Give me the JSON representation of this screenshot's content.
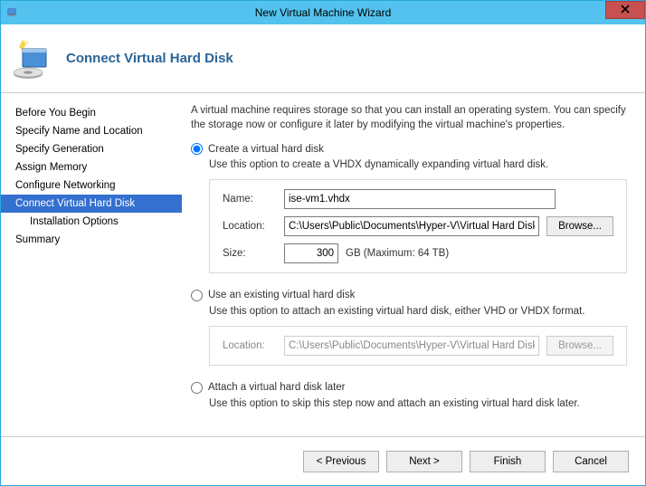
{
  "window": {
    "title": "New Virtual Machine Wizard"
  },
  "header": {
    "title": "Connect Virtual Hard Disk"
  },
  "sidebar": {
    "items": [
      {
        "label": "Before You Begin"
      },
      {
        "label": "Specify Name and Location"
      },
      {
        "label": "Specify Generation"
      },
      {
        "label": "Assign Memory"
      },
      {
        "label": "Configure Networking"
      },
      {
        "label": "Connect Virtual Hard Disk",
        "selected": true,
        "children": [
          {
            "label": "Installation Options"
          }
        ]
      },
      {
        "label": "Summary"
      }
    ]
  },
  "content": {
    "intro": "A virtual machine requires storage so that you can install an operating system. You can specify the storage now or configure it later by modifying the virtual machine's properties.",
    "option_create": {
      "label": "Create a virtual hard disk",
      "hint": "Use this option to create a VHDX dynamically expanding virtual hard disk.",
      "name_label": "Name:",
      "name_value": "ise-vm1.vhdx",
      "location_label": "Location:",
      "location_value": "C:\\Users\\Public\\Documents\\Hyper-V\\Virtual Hard Disks\\",
      "browse_label": "Browse...",
      "size_label": "Size:",
      "size_value": "300",
      "size_unit": "GB (Maximum: 64 TB)"
    },
    "option_existing": {
      "label": "Use an existing virtual hard disk",
      "hint": "Use this option to attach an existing virtual hard disk, either VHD or VHDX format.",
      "location_label": "Location:",
      "location_value": "C:\\Users\\Public\\Documents\\Hyper-V\\Virtual Hard Disks\\",
      "browse_label": "Browse..."
    },
    "option_later": {
      "label": "Attach a virtual hard disk later",
      "hint": "Use this option to skip this step now and attach an existing virtual hard disk later."
    }
  },
  "footer": {
    "previous": "< Previous",
    "next": "Next >",
    "finish": "Finish",
    "cancel": "Cancel"
  }
}
